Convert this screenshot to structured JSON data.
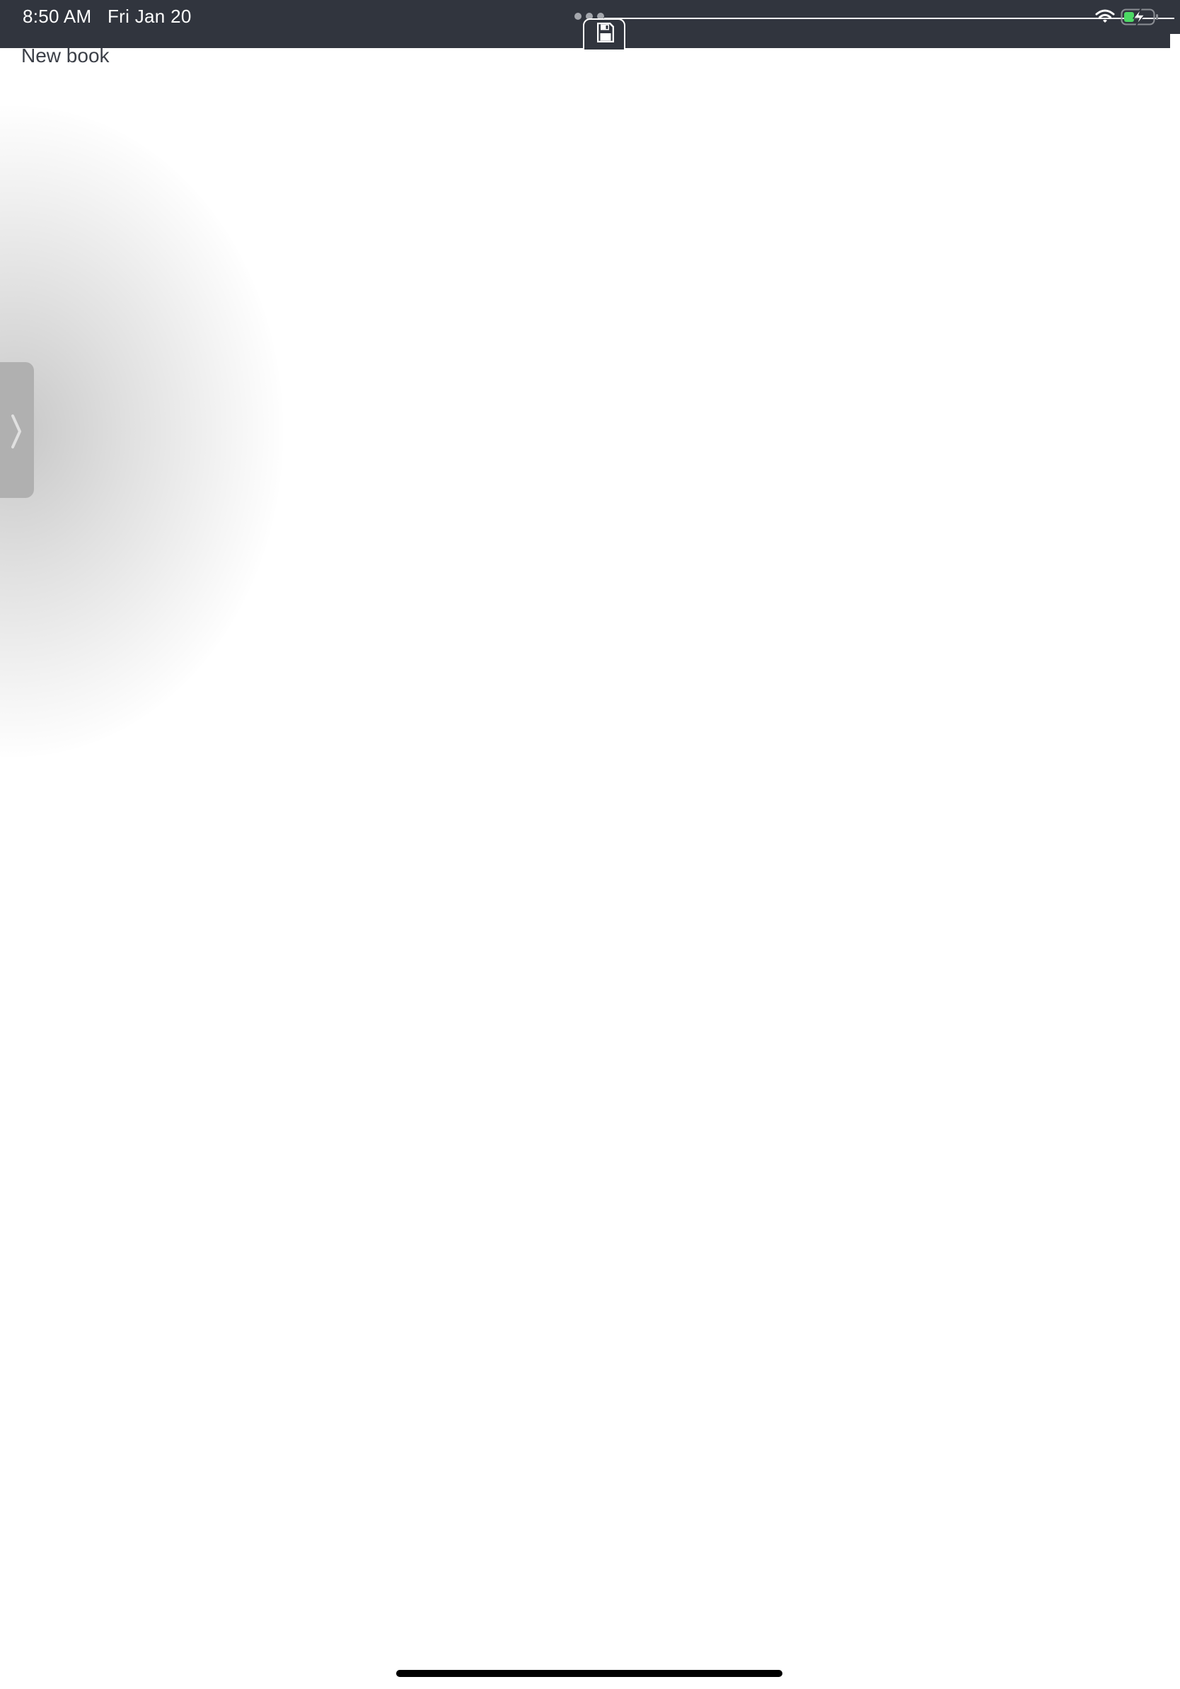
{
  "status_bar": {
    "time": "8:50 AM",
    "date": "Fri Jan 20",
    "wifi_icon": "wifi-icon",
    "battery_icon": "battery-charging-icon",
    "battery_color": "#4cd964"
  },
  "toolbar": {
    "save_icon": "floppy-disk-icon",
    "background_color": "#31353e"
  },
  "document": {
    "title": "New book"
  },
  "sidebar": {
    "handle_icon": "chevron-right-icon"
  }
}
